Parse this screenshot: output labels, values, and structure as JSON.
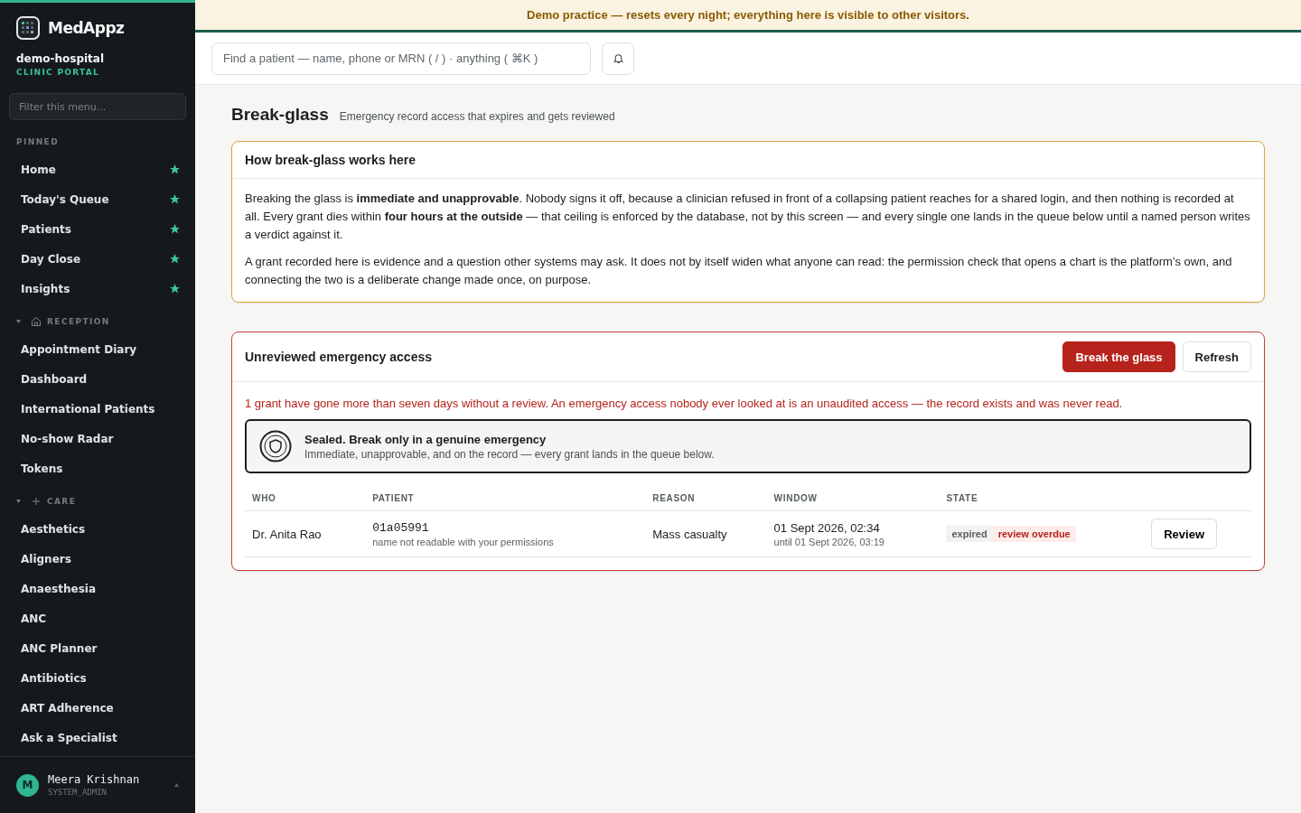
{
  "banner": {
    "text": "Demo practice — resets every night; everything here is visible to other visitors."
  },
  "sidebar": {
    "brand": "MedAppz",
    "org": "demo-hospital",
    "portal": "CLINIC PORTAL",
    "filter": {
      "placeholder": "Filter this menu..."
    },
    "sections": [
      {
        "title": "PINNED",
        "kind": "pinned",
        "items": [
          {
            "label": "Home",
            "pinned": true
          },
          {
            "label": "Today's Queue",
            "pinned": true
          },
          {
            "label": "Patients",
            "pinned": true
          },
          {
            "label": "Day Close",
            "pinned": true
          },
          {
            "label": "Insights",
            "pinned": true
          }
        ]
      },
      {
        "title": "RECEPTION",
        "kind": "group",
        "expanded": true,
        "items": [
          {
            "label": "Appointment Diary"
          },
          {
            "label": "Dashboard"
          },
          {
            "label": "International Patients"
          },
          {
            "label": "No-show Radar"
          },
          {
            "label": "Tokens"
          }
        ]
      },
      {
        "title": "CARE",
        "kind": "group",
        "expanded": true,
        "items": [
          {
            "label": "Aesthetics"
          },
          {
            "label": "Aligners"
          },
          {
            "label": "Anaesthesia"
          },
          {
            "label": "ANC"
          },
          {
            "label": "ANC Planner"
          },
          {
            "label": "Antibiotics"
          },
          {
            "label": "ART Adherence"
          },
          {
            "label": "Ask a Specialist"
          }
        ]
      }
    ],
    "user": {
      "initial": "M",
      "name": "Meera Krishnan",
      "role": "SYSTEM_ADMIN"
    }
  },
  "search": {
    "placeholder": "Find a patient — name, phone or MRN ( / ) · anything ( ⌘K )"
  },
  "page": {
    "title": "Break-glass",
    "subtitle": "Emergency record access that expires and gets reviewed"
  },
  "info_card": {
    "title": "How break-glass works here",
    "paragraphs": [
      "Breaking the glass is **immediate and unapprovable**. Nobody signs it off, because a clinician refused in front of a collapsing patient reaches for a shared login, and then nothing is recorded at all. Every grant dies within **four hours at the outside** — that ceiling is enforced by the database, not by this screen — and every single one lands in the queue below until a named person writes a verdict against it.",
      "A grant recorded here is evidence and a question other systems may ask. It does not by itself widen what anyone can read: the permission check that opens a chart is the platform’s own, and connecting the two is a deliberate change made once, on purpose."
    ]
  },
  "grants": {
    "title": "Unreviewed emergency access",
    "buttons": [
      {
        "label": "Break the glass",
        "kind": "primary"
      },
      {
        "label": "Refresh",
        "kind": "secondary"
      }
    ],
    "warning": "1 grant have gone more than seven days without a review. An emergency access nobody ever looked at is an unaudited access — the record exists and was never read.",
    "sealed": {
      "title": "Sealed. Break only in a genuine emergency",
      "text": "Immediate, unapprovable, and on the record — every grant lands in the queue below."
    },
    "table": {
      "columns": [
        "WHO",
        "PATIENT",
        "REASON",
        "WINDOW",
        "STATE"
      ],
      "rows": [
        {
          "who": "Dr. Anita Rao",
          "patient_id": "01a05991",
          "patient_note": "name not readable with your permissions",
          "reason": "Mass casualty",
          "window_start": "01 Sept 2026, 02:34",
          "window_end": "until 01 Sept 2026, 03:19",
          "tags": [
            {
              "label": "expired",
              "kind": "neutral"
            },
            {
              "label": "review overdue",
              "kind": "alert"
            }
          ],
          "action": "Review"
        }
      ]
    }
  }
}
